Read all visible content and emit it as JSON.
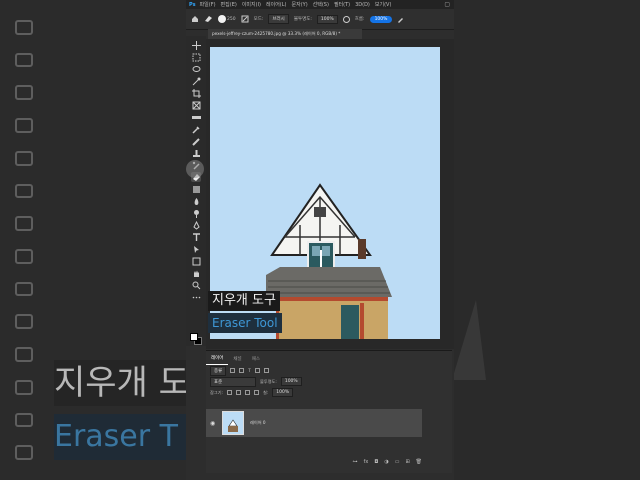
{
  "app": {
    "logo": "Ps",
    "menu": [
      "파일(F)",
      "편집(E)",
      "이미지(I)",
      "레이어(L)",
      "문자(Y)",
      "선택(S)",
      "필터(T)",
      "3D(D)",
      "보기(V)"
    ],
    "window_icon": "window-icon"
  },
  "options": {
    "brush_size": "250",
    "mode_label": "모드:",
    "mode_value": "브러시",
    "opacity_label": "불투명도:",
    "opacity_value": "100%",
    "flow_label": "흐름:",
    "flow_value": "100%"
  },
  "document": {
    "tab_title": "pexels-jeffrey-czum-2425780.jpg @ 33.3% (레이어 0, RGB/8) *"
  },
  "captions": {
    "korean": "지우개 도구",
    "english": "Eraser Tool"
  },
  "background_frame": {
    "korean": "지우개 도",
    "english": "Eraser T"
  },
  "layers_panel": {
    "tabs": [
      "레이어",
      "채널",
      "패스"
    ],
    "filter_label": "종류",
    "blend_mode": "표준",
    "opacity_label": "불투명도:",
    "opacity_value": "100%",
    "lock_label": "잠그기:",
    "fill_label": "칠:",
    "fill_value": "100%",
    "layer_name": "레이어 0",
    "bottom_icons": [
      "link-icon",
      "fx-icon",
      "mask-icon",
      "adjustment-icon",
      "group-icon",
      "new-layer-icon",
      "trash-icon"
    ]
  },
  "colors": {
    "sky": "#bcdcf5",
    "accent": "#1473e6",
    "caption_blue": "#3e97d6"
  }
}
